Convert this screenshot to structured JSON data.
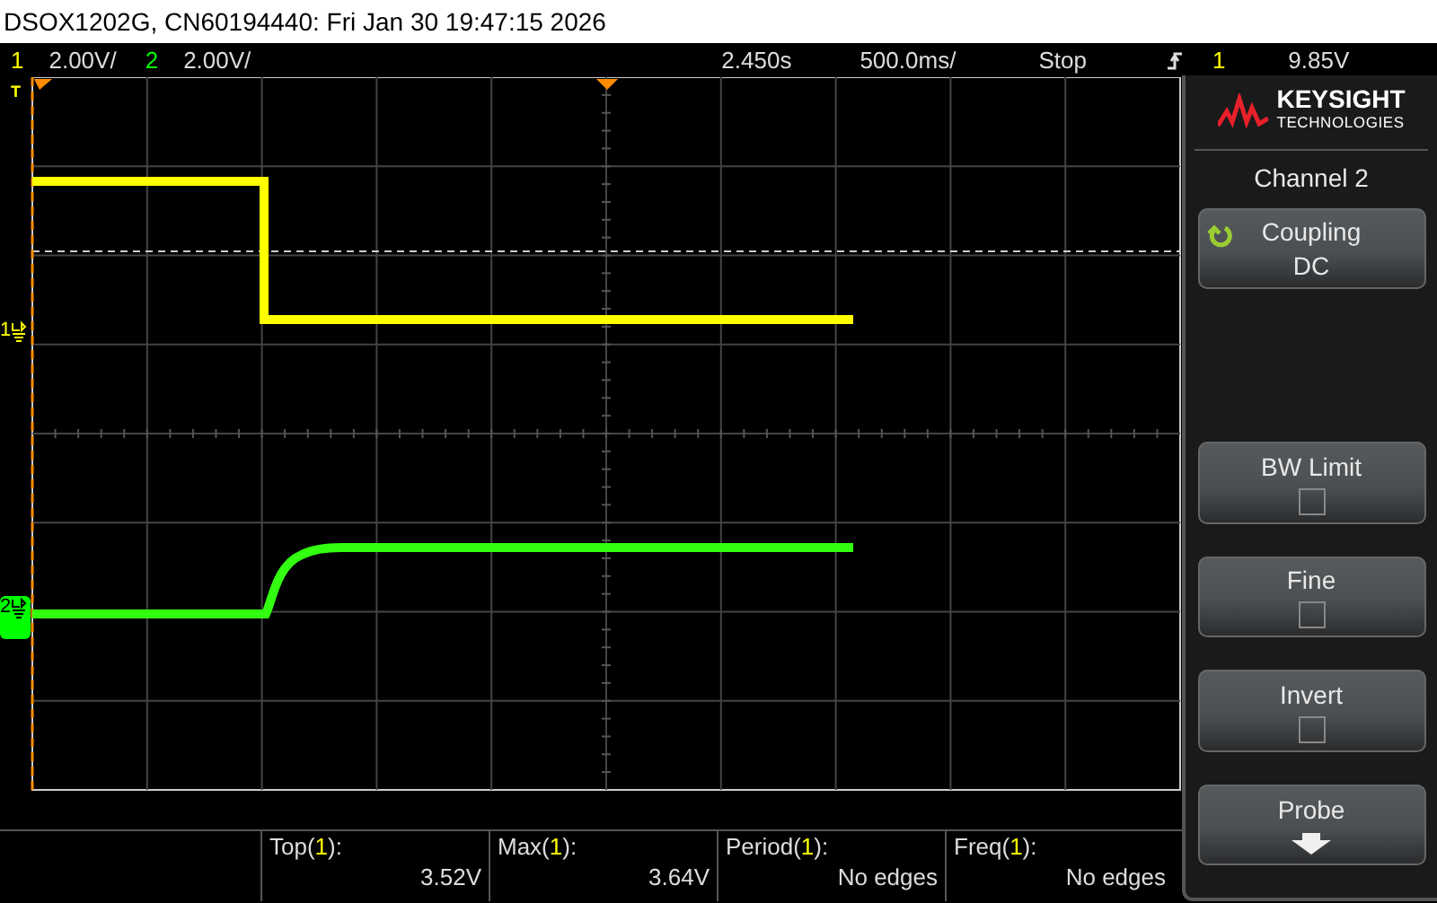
{
  "title_bar": {
    "text": "DSOX1202G, CN60194440: Fri Jan 30 19:47:15 2026"
  },
  "status_bar": {
    "channels": [
      {
        "number": "1",
        "scale": "2.00V/",
        "color": "#ffff00"
      },
      {
        "number": "2",
        "scale": "2.00V/",
        "color": "#00ff00"
      }
    ],
    "time_position": "2.450s",
    "time_scale": "500.0ms/",
    "run_state": "Stop",
    "trigger": {
      "source": "1",
      "level": "9.85V"
    }
  },
  "graticule": {
    "markers": [
      {
        "kind": "trigger",
        "label": "T"
      },
      {
        "kind": "channel",
        "label": "1",
        "color": "#ffff00"
      },
      {
        "kind": "channel",
        "label": "2",
        "color": "#00ff00"
      }
    ],
    "traces": [
      {
        "kind": "step-down",
        "color": "#ffff00"
      },
      {
        "kind": "step-up",
        "color": "#33ff11"
      }
    ]
  },
  "measurements": [
    {
      "label_start": "Top(",
      "channel": "1",
      "label_end": "):",
      "value": "3.52V"
    },
    {
      "label_start": "Max(",
      "channel": "1",
      "label_end": "):",
      "value": "3.64V"
    },
    {
      "label_start": "Period(",
      "channel": "1",
      "label_end": "):",
      "value": "No edges"
    },
    {
      "label_start": "Freq(",
      "channel": "1",
      "label_end": "):",
      "value": "No edges"
    }
  ],
  "softkey_menu": {
    "brand": {
      "name": "KEYSIGHT",
      "subtitle": "TECHNOLOGIES"
    },
    "title": "Channel 2",
    "softkeys": [
      {
        "kind": "cycle",
        "label": "Coupling",
        "value": "DC"
      },
      {
        "kind": "checkbox",
        "label": "BW Limit",
        "checked": false
      },
      {
        "kind": "checkbox",
        "label": "Fine",
        "checked": false
      },
      {
        "kind": "checkbox",
        "label": "Invert",
        "checked": false
      },
      {
        "kind": "submenu",
        "label": "Probe"
      }
    ]
  }
}
